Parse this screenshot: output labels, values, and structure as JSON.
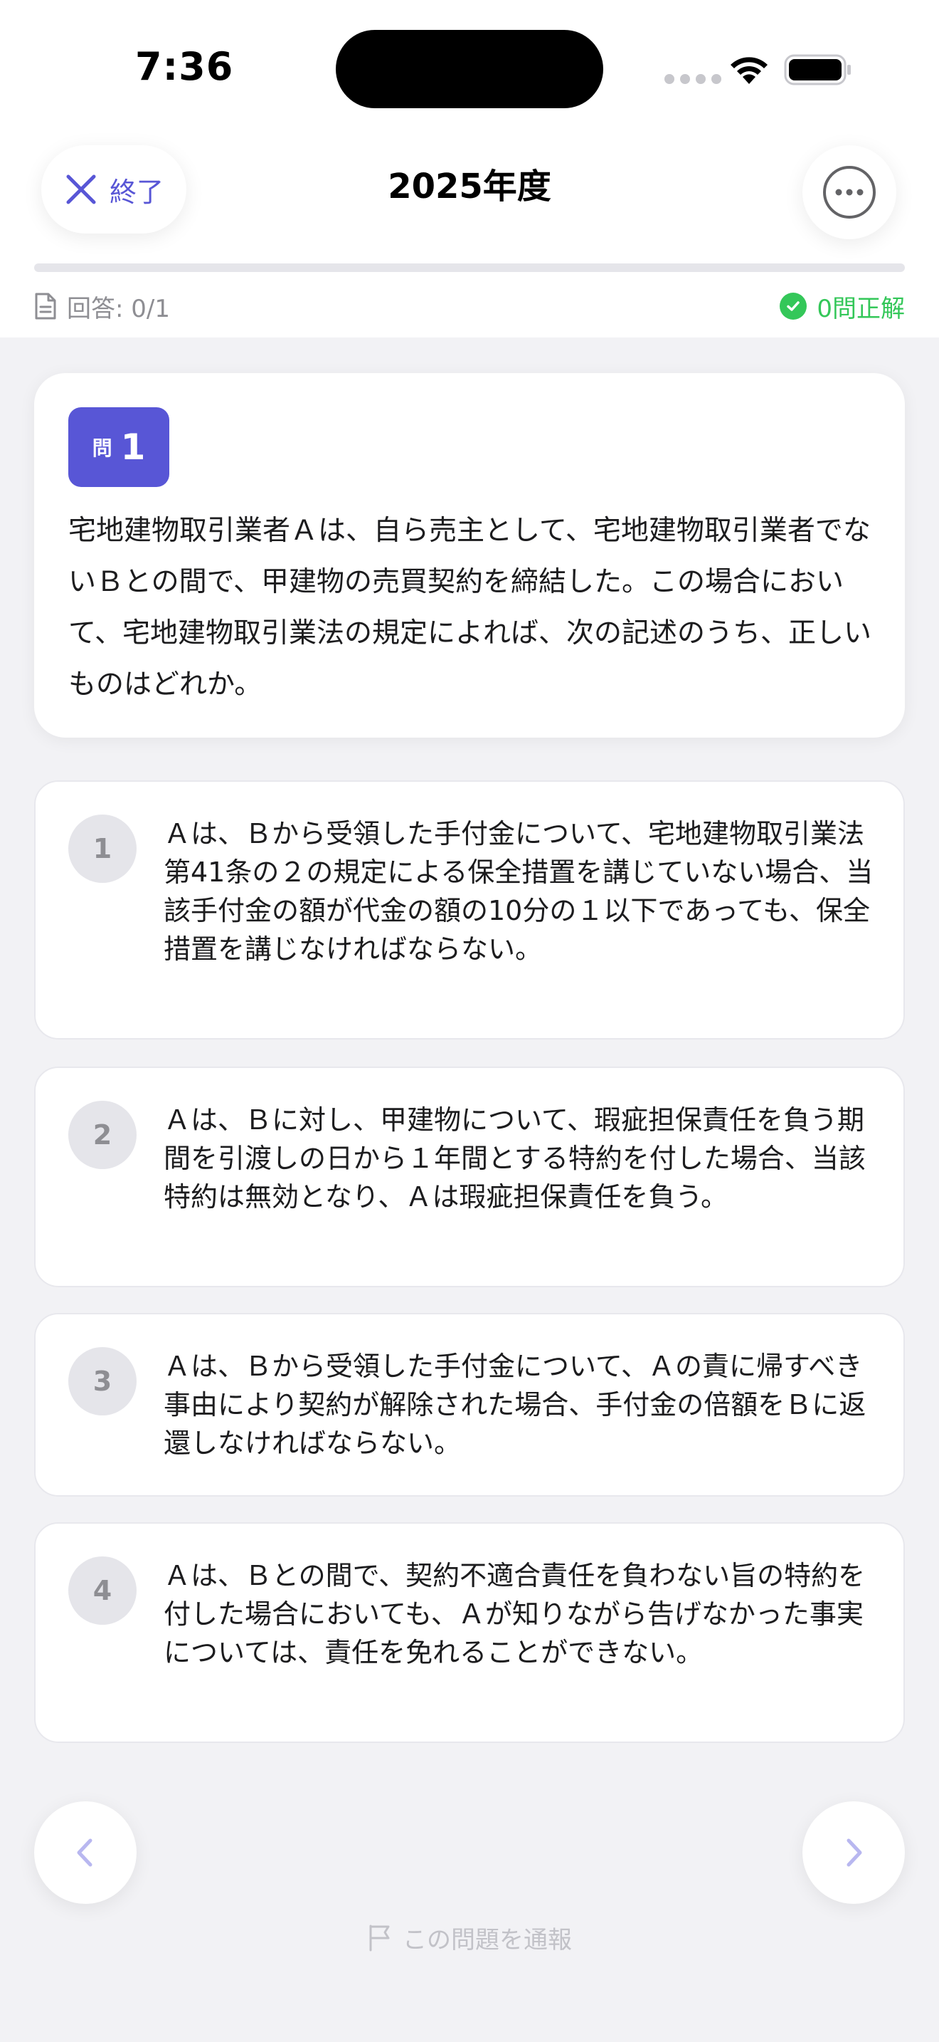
{
  "status_bar": {
    "time": "7:36"
  },
  "nav": {
    "close_label": "終了",
    "title": "2025年度"
  },
  "progress": {
    "answered_label": "回答: 0/1",
    "answered_fraction": 0,
    "correct_label": "0問正解"
  },
  "question": {
    "badge_prefix": "問",
    "number": "1",
    "text": "宅地建物取引業者Ａは、自ら売主として、宅地建物取引業者でないＢとの間で、甲建物の売買契約を締結した。この場合において、宅地建物取引業法の規定によれば、次の記述のうち、正しいものはどれか。"
  },
  "options": [
    {
      "number": "1",
      "text": "Ａは、Ｂから受領した手付金について、宅地建物取引業法第41条の２の規定による保全措置を講じていない場合、当該手付金の額が代金の額の10分の１以下であっても、保全措置を講じなければならない。"
    },
    {
      "number": "2",
      "text": "Ａは、Ｂに対し、甲建物について、瑕疵担保責任を負う期間を引渡しの日から１年間とする特約を付した場合、当該特約は無効となり、Ａは瑕疵担保責任を負う。"
    },
    {
      "number": "3",
      "text": "Ａは、Ｂから受領した手付金について、Ａの責に帰すべき事由により契約が解除された場合、手付金の倍額をＢに返還しなければならない。"
    },
    {
      "number": "4",
      "text": "Ａは、Ｂとの間で、契約不適合責任を負わない旨の特約を付した場合においても、Ａが知りながら告げなかった事実については、責任を免れることができない。"
    }
  ],
  "footer": {
    "report_label": "この問題を通報"
  },
  "colors": {
    "accent": "#5856d6",
    "success": "#34c759",
    "background": "#f2f2f5"
  },
  "icons": {
    "close": "close-icon",
    "more": "more-icon",
    "document": "document-icon",
    "check": "check-circle-icon",
    "prev": "chevron-left-icon",
    "next": "chevron-right-icon",
    "flag": "flag-icon"
  }
}
